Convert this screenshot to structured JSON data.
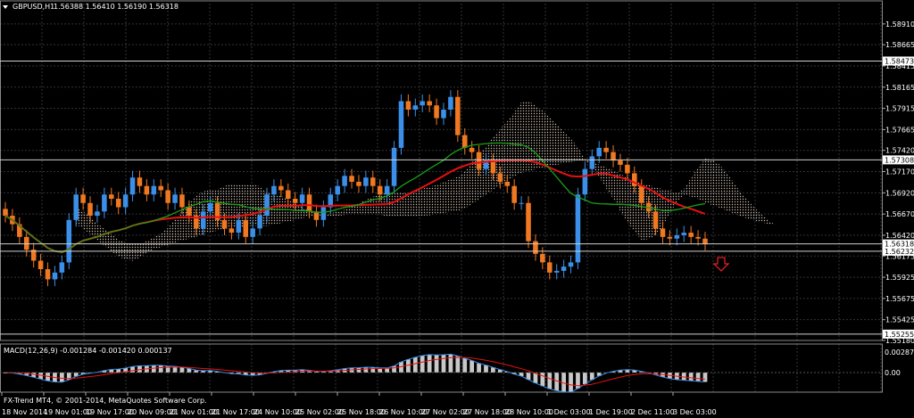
{
  "header": {
    "symbol": "GBPUSD,H1",
    "ohlc": "1.56388 1.56410 1.56190 1.56318"
  },
  "macd": {
    "label": "MACD(12,26,9) -0.001284 -0.001420 0.000137",
    "axis_top": "0.002871",
    "axis_mid": "0.00"
  },
  "watermark": "FX-Trend MT4, © 2001-2014, MetaQuotes Software Corp.",
  "price_axis": [
    "1.58910",
    "1.58665",
    "1.58415",
    "1.58165",
    "1.57915",
    "1.57665",
    "1.57420",
    "1.57170",
    "1.56920",
    "1.56670",
    "1.56420",
    "1.56175",
    "1.55925",
    "1.55675",
    "1.55425",
    "1.55180"
  ],
  "price_tags": [
    "1.58473",
    "1.57308",
    "1.56318",
    "1.56232",
    "1.55255"
  ],
  "time_axis": [
    "18 Nov 2014",
    "19 Nov 01:00",
    "19 Nov 17:00",
    "20 Nov 09:00",
    "21 Nov 01:00",
    "21 Nov 17:00",
    "24 Nov 10:00",
    "25 Nov 02:00",
    "25 Nov 18:00",
    "26 Nov 10:00",
    "27 Nov 02:00",
    "27 Nov 18:00",
    "28 Nov 10:00",
    "1 Dec 03:00",
    "1 Dec 19:00",
    "2 Dec 11:00",
    "3 Dec 03:00"
  ],
  "colors": {
    "background": "#000000",
    "grid": "#33333d",
    "bull": "#3b8fe8",
    "bear": "#f07820",
    "ma_red": "#e81010",
    "ma_green": "#18a018",
    "cloud": "#c8b8a8",
    "macd_hist": "#c8c8c8",
    "signal_arrow": "#e02020"
  },
  "chart_data": {
    "type": "candlestick",
    "symbol": "GBPUSD",
    "timeframe": "H1",
    "ylim": [
      1.5518,
      1.5915
    ],
    "last_close": 1.56318,
    "closes": [
      1.5665,
      1.5655,
      1.564,
      1.5625,
      1.5612,
      1.5602,
      1.559,
      1.5598,
      1.561,
      1.566,
      1.569,
      1.568,
      1.5665,
      1.567,
      1.569,
      1.5685,
      1.5675,
      1.569,
      1.571,
      1.57,
      1.569,
      1.57,
      1.5695,
      1.568,
      1.569,
      1.5675,
      1.5665,
      1.565,
      1.567,
      1.568,
      1.566,
      1.565,
      1.5645,
      1.566,
      1.564,
      1.565,
      1.5665,
      1.569,
      1.57,
      1.5695,
      1.5685,
      1.568,
      1.569,
      1.567,
      1.566,
      1.5675,
      1.569,
      1.57,
      1.5712,
      1.5705,
      1.57,
      1.571,
      1.57,
      1.569,
      1.57,
      1.5745,
      1.58,
      1.579,
      1.5795,
      1.58,
      1.5795,
      1.578,
      1.579,
      1.5805,
      1.576,
      1.5745,
      1.574,
      1.572,
      1.573,
      1.5715,
      1.5705,
      1.57,
      1.568,
      1.568,
      1.5635,
      1.562,
      1.561,
      1.5598,
      1.56,
      1.5605,
      1.561,
      1.569,
      1.572,
      1.5735,
      1.5745,
      1.574,
      1.573,
      1.5725,
      1.5715,
      1.57,
      1.568,
      1.567,
      1.565,
      1.564,
      1.5638,
      1.5642,
      1.5645,
      1.564,
      1.5638,
      1.5632
    ],
    "series": [
      {
        "name": "MA",
        "color": "red"
      },
      {
        "name": "MA",
        "color": "green"
      }
    ],
    "macd_params": "12,26,9",
    "macd_values": [
      -0.001284,
      -0.00142,
      0.000137
    ]
  }
}
